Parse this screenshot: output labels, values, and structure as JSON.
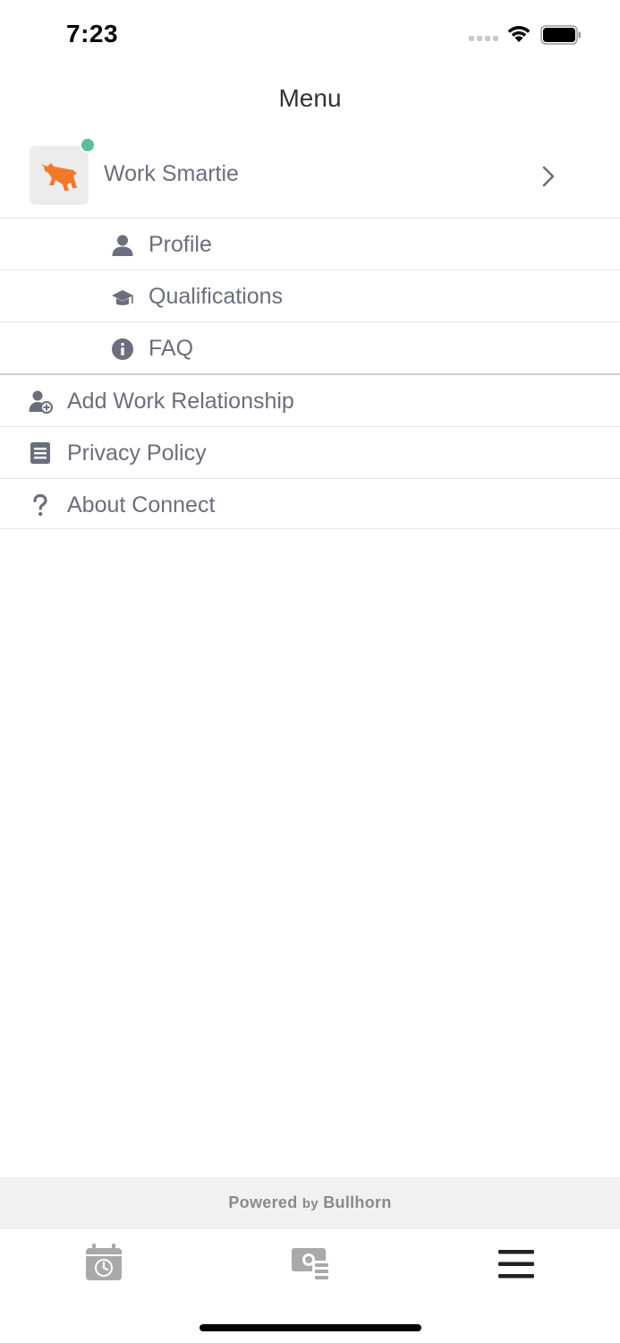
{
  "status_bar": {
    "time": "7:23"
  },
  "header": {
    "title": "Menu"
  },
  "account": {
    "name": "Work Smartie",
    "online_color": "#5bbf9a",
    "logo_color": "#f07a2a"
  },
  "submenu": [
    {
      "label": "Profile",
      "icon": "person-icon"
    },
    {
      "label": "Qualifications",
      "icon": "graduation-cap-icon"
    },
    {
      "label": "FAQ",
      "icon": "info-circle-icon"
    }
  ],
  "menu": [
    {
      "label": "Add Work Relationship",
      "icon": "add-user-icon"
    },
    {
      "label": "Privacy Policy",
      "icon": "document-icon"
    },
    {
      "label": "About Connect",
      "icon": "question-mark-icon"
    }
  ],
  "footer": {
    "powered_prefix": "Powered",
    "powered_by": "by",
    "powered_brand": "Bullhorn"
  },
  "tabbar": {
    "tabs": [
      {
        "name": "schedule",
        "icon": "calendar-clock-icon",
        "active": false
      },
      {
        "name": "pay",
        "icon": "money-icon",
        "active": false
      },
      {
        "name": "menu",
        "icon": "hamburger-menu-icon",
        "active": true
      }
    ]
  },
  "colors": {
    "text": "#6b6e7c",
    "icon": "#6b6e7c",
    "inactive_tab": "#a9a9a9",
    "active_tab": "#222222",
    "divider": "#e3e3e6"
  }
}
